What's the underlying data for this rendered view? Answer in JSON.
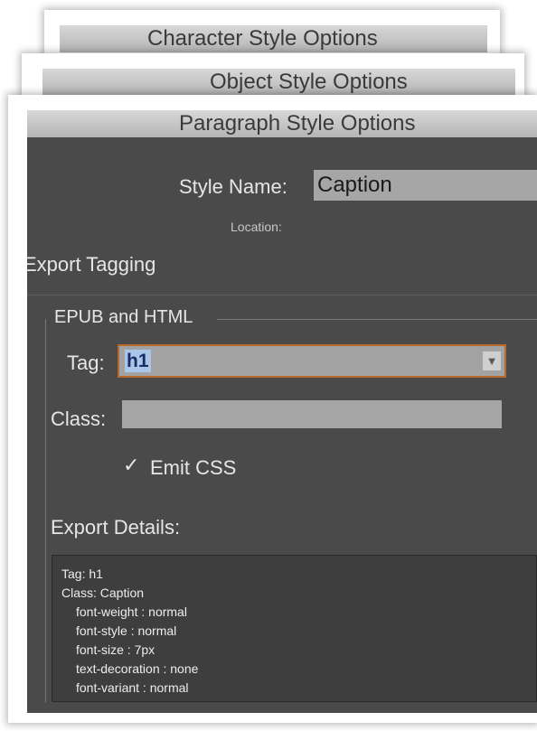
{
  "dialogs": {
    "character": {
      "title": "Character Style Options"
    },
    "object": {
      "title": "Object Style Options"
    },
    "paragraph": {
      "title": "Paragraph Style Options"
    }
  },
  "general": {
    "style_name_label": "Style Name:",
    "style_name_value": "Caption",
    "location_label": "Location:"
  },
  "section_title": "Export Tagging",
  "epub_group": {
    "label": "EPUB and HTML",
    "tag_label": "Tag:",
    "tag_value": "h1",
    "tag_dropdown_icon": "chevron-down-icon",
    "class_label": "Class:",
    "class_value": "",
    "emit_css_checkbox": {
      "label": "Emit CSS",
      "checked": true,
      "mark": "✓"
    }
  },
  "export_details": {
    "label": "Export Details:",
    "lines": [
      "Tag: h1",
      "Class: Caption",
      "font-weight : normal",
      "font-style : normal",
      "font-size : 7px",
      "text-decoration : none",
      "font-variant : normal"
    ]
  },
  "colors": {
    "panel_bg": "#4a4a4a",
    "title_bar": "#c4c4c4",
    "focus_ring": "#b86a2a",
    "selection_highlight": "#aac7ea"
  }
}
